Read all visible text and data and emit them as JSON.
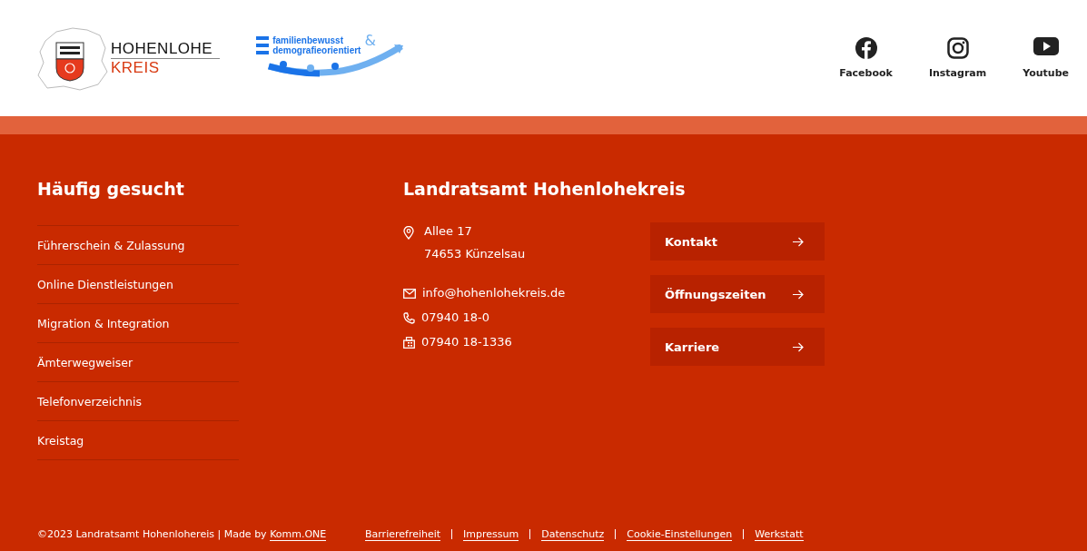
{
  "header": {
    "logo": {
      "line_1": "HOHENLOHE",
      "line_2": "KREIS"
    },
    "badge": {
      "line_1": "familienbewusst",
      "ampersand": "&",
      "line_2": "demografieorientiert"
    },
    "social": [
      {
        "kind": "facebook",
        "label": "Facebook"
      },
      {
        "kind": "instagram",
        "label": "Instagram"
      },
      {
        "kind": "youtube",
        "label": "Youtube"
      }
    ]
  },
  "frequently_searched": {
    "title": "Häufig gesucht",
    "links": [
      "Führerschein & Zulassung",
      "Online Dienstleistungen",
      "Migration & Integration",
      "Ämterwegweiser",
      "Telefonverzeichnis",
      "Kreistag"
    ]
  },
  "office": {
    "title": "Landratsamt Hohenlohekreis",
    "address": [
      "Allee 17",
      "74653 Künzelsau"
    ],
    "contacts": [
      {
        "kind": "email",
        "text": "info@hohenlohekreis.de"
      },
      {
        "kind": "phone",
        "text": "07940 18-0"
      },
      {
        "kind": "fax",
        "text": "07940 18-1336"
      }
    ],
    "buttons": [
      "Kontakt",
      "Öffnungszeiten",
      "Karriere"
    ]
  },
  "footer": {
    "copyright": "©2023 Landratsamt Hohenlohereis | Made by ",
    "maker_link": "Komm.ONE",
    "links": [
      "Barrierefreiheit",
      "Impressum",
      "Datenschutz",
      "Cookie-Einstellungen",
      "Werkstatt"
    ]
  }
}
